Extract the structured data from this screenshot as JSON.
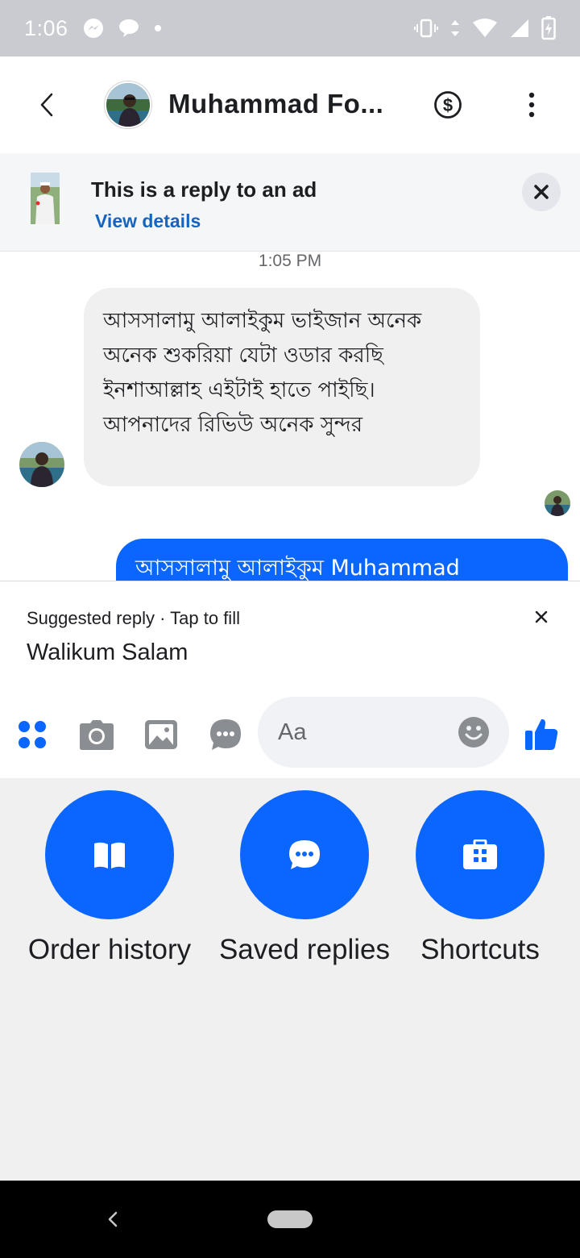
{
  "status_bar": {
    "time": "1:06",
    "icons": [
      "messenger-icon",
      "chat-bubble-icon",
      "dot-icon",
      "vibrate-icon",
      "data-arrows-icon",
      "wifi-icon",
      "cell-signal-icon",
      "battery-charging-icon"
    ]
  },
  "header": {
    "contact_name": "Muhammad Fo...",
    "icons": [
      "back-icon",
      "contact-avatar",
      "dollar-icon",
      "more-vertical-icon"
    ]
  },
  "ad_banner": {
    "title": "This is a reply to an ad",
    "link": "View details"
  },
  "chat": {
    "timestamp": "1:05 PM",
    "incoming_message": "আসসালামু আলাইকুম ভাইজান অনেক অনেক শুকরিয়া যেটা ওডার করছি ইনশাআল্লাহ এইটাই হাতে পাইছি। আপনাদের রিভিউ অনেক সুন্দর",
    "outgoing_message": "আসসালামু আলাইকুম Muhammad"
  },
  "suggested_reply": {
    "label": "Suggested reply · Tap to fill",
    "text": "Walikum Salam"
  },
  "composer": {
    "placeholder": "Aa",
    "icons": [
      "apps-icon",
      "camera-icon",
      "gallery-icon",
      "chat-more-icon",
      "emoji-icon",
      "thumbs-up-icon"
    ]
  },
  "tray": {
    "items": [
      {
        "label": "Order history",
        "icon": "book-icon"
      },
      {
        "label": "Saved replies",
        "icon": "chat-bubble-icon"
      },
      {
        "label": "Shortcuts",
        "icon": "briefcase-icon"
      }
    ]
  },
  "colors": {
    "accent": "#0a66ff",
    "link": "#1565c0",
    "status_bar": "#c9cbd0",
    "tray_background": "#f0f0f0",
    "incoming_bubble": "#f0f0f0"
  }
}
